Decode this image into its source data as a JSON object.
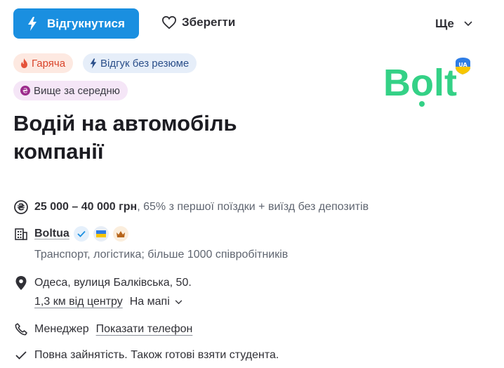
{
  "toolbar": {
    "respond_label": "Відгукнутися",
    "save_label": "Зберегти",
    "more_label": "Ще"
  },
  "tags": {
    "hot": "Гаряча",
    "no_resume": "Відгук без резюме",
    "salary": "Вище за середню"
  },
  "logo": {
    "brand": "Bolt",
    "badge": "UA"
  },
  "vacancy": {
    "title_line1": "Водій на автомобіль",
    "title_line2": "компанії"
  },
  "salary": {
    "range": "25 000 – 40 000 грн",
    "note": ", 65% з першої поїздки + виїзд без депозитів"
  },
  "company": {
    "name": "Boltua",
    "description": "Транспорт, логістика; більше 1000 співробітників"
  },
  "location": {
    "address": "Одеса, вулиця Балківська, 50.",
    "distance": "1,3 км від центру",
    "map_label": "На мапі"
  },
  "contact": {
    "person": "Менеджер",
    "show_phone": "Показати телефон"
  },
  "employment": {
    "text": "Повна зайнятість. Також готові взяти студента."
  },
  "colors": {
    "accent": "#1a8fe0",
    "bolt_green": "#34d186"
  }
}
